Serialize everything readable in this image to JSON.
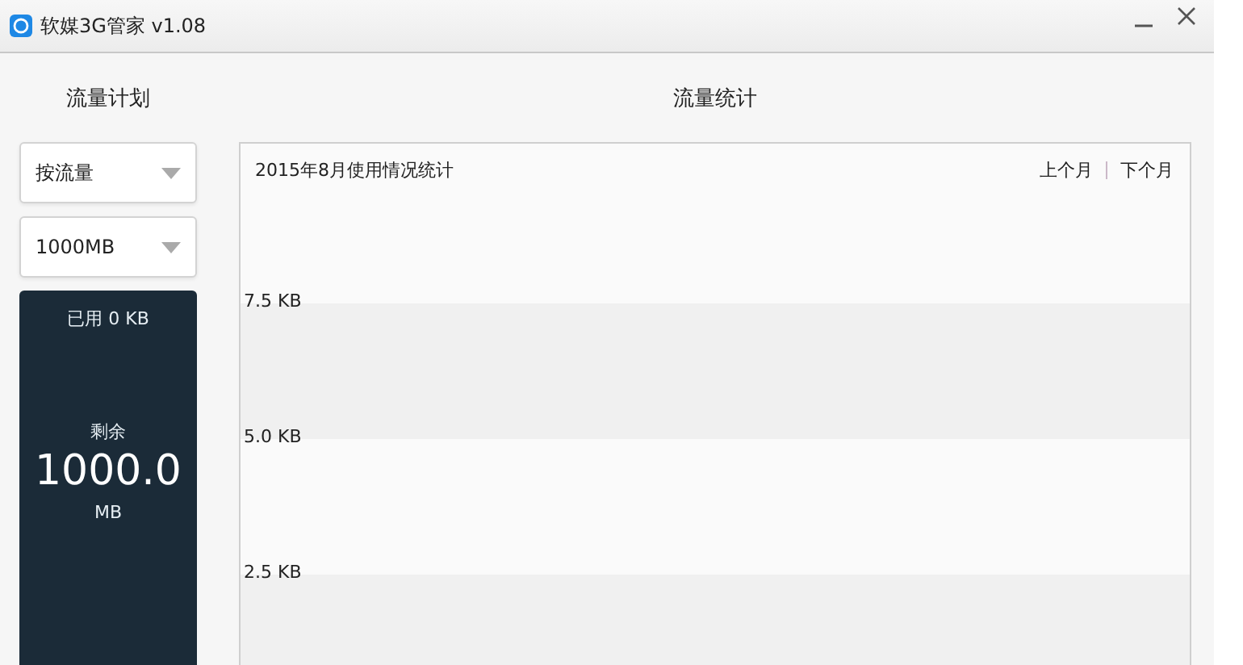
{
  "window": {
    "title": "软媒3G管家 v1.08"
  },
  "plan": {
    "heading": "流量计划",
    "selects": [
      {
        "value": "按流量"
      },
      {
        "value": "1000MB"
      }
    ],
    "usage": {
      "used": "已用 0 KB",
      "remaining_label": "剩余",
      "remaining_value": "1000.0",
      "remaining_unit": "MB"
    }
  },
  "stats": {
    "heading": "流量统计",
    "title": "2015年8月使用情况统计",
    "nav": [
      "上个月",
      "下个月"
    ],
    "y_labels": [
      "7.5 KB",
      "5.0 KB",
      "2.5 KB"
    ]
  }
}
